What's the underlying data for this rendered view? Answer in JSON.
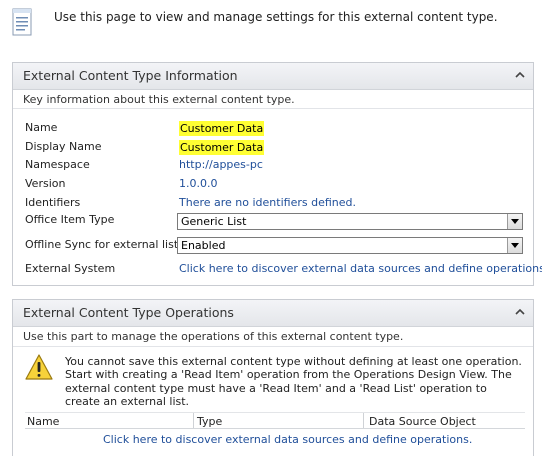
{
  "page": {
    "intro_text": "Use this page to view and manage settings for this external content type.",
    "page_icon": "document-page-icon"
  },
  "info_panel": {
    "title": "External Content Type Information",
    "description": "Key information about this external content type.",
    "collapse_icon": "chevron-up-icon",
    "fields": {
      "name": {
        "label": "Name",
        "value": "Customer Data"
      },
      "display_name": {
        "label": "Display Name",
        "value": "Customer Data"
      },
      "namespace": {
        "label": "Namespace",
        "value": "http://appes-pc"
      },
      "version": {
        "label": "Version",
        "value": "1.0.0.0"
      },
      "identifiers": {
        "label": "Identifiers",
        "value": "There are no identifiers defined."
      },
      "office_item_type": {
        "label": "Office Item Type",
        "value": "Generic List"
      },
      "offline_sync": {
        "label": "Offline Sync for external list",
        "value": "Enabled"
      },
      "external_system": {
        "label": "External System",
        "value": "Click here to discover external data sources and define operations."
      }
    },
    "highlight_color": "#ffff33",
    "link_color": "#1f4e99"
  },
  "ops_panel": {
    "title": "External Content Type Operations",
    "description": "Use this part to manage the operations of this external content type.",
    "collapse_icon": "chevron-up-icon",
    "warning_icon": "warning-icon",
    "warning_text": "You cannot save this external content type without defining at least one operation. Start with creating a 'Read Item' operation from the Operations Design View. The external content type must have a 'Read Item' and a 'Read List' operation to create an external list.",
    "columns": [
      "Name",
      "Type",
      "Data Source Object"
    ],
    "discover_link": "Click here to discover external data sources and define operations."
  }
}
